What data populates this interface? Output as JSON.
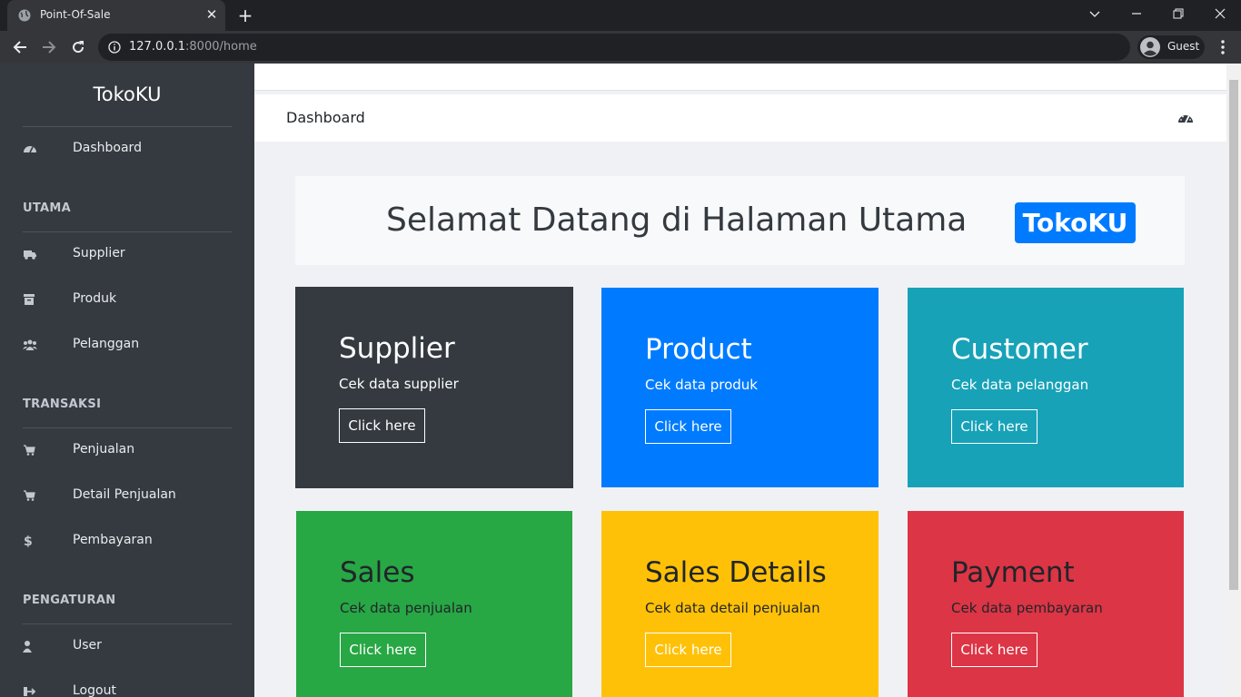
{
  "browser": {
    "tab_title": "Point-Of-Sale",
    "url_host": "127.0.0.1",
    "url_rest": ":8000/home",
    "profile_name": "Guest"
  },
  "sidebar": {
    "brand": "TokoKU",
    "dashboard_label": "Dashboard",
    "sections": [
      {
        "title": "UTAMA",
        "items": [
          {
            "label": "Supplier",
            "icon": "truck-icon"
          },
          {
            "label": "Produk",
            "icon": "archive-icon"
          },
          {
            "label": "Pelanggan",
            "icon": "users-icon"
          }
        ]
      },
      {
        "title": "TRANSAKSI",
        "items": [
          {
            "label": "Penjualan",
            "icon": "cart-icon"
          },
          {
            "label": "Detail Penjualan",
            "icon": "cart-icon"
          },
          {
            "label": "Pembayaran",
            "icon": "dollar-icon"
          }
        ]
      },
      {
        "title": "PENGATURAN",
        "items": [
          {
            "label": "User",
            "icon": "user-icon"
          },
          {
            "label": "Logout",
            "icon": "logout-icon"
          }
        ]
      }
    ]
  },
  "header": {
    "title": "Dashboard"
  },
  "jumbotron": {
    "text": "Selamat Datang di Halaman Utama",
    "badge": "TokoKU"
  },
  "cards": [
    {
      "title": "Supplier",
      "text": "Cek data supplier",
      "button": "Click here",
      "bg": "#343a40",
      "fg": "#ffffff"
    },
    {
      "title": "Product",
      "text": "Cek data produk",
      "button": "Click here",
      "bg": "#007bff",
      "fg": "#ffffff"
    },
    {
      "title": "Customer",
      "text": "Cek data pelanggan",
      "button": "Click here",
      "bg": "#17a2b8",
      "fg": "#ffffff"
    },
    {
      "title": "Sales",
      "text": "Cek data penjualan",
      "button": "Click here",
      "bg": "#28a745",
      "fg": "#212529"
    },
    {
      "title": "Sales Details",
      "text": "Cek data detail penjualan",
      "button": "Click here",
      "bg": "#ffc107",
      "fg": "#212529"
    },
    {
      "title": "Payment",
      "text": "Cek data pembayaran",
      "button": "Click here",
      "bg": "#dc3545",
      "fg": "#212529"
    }
  ]
}
